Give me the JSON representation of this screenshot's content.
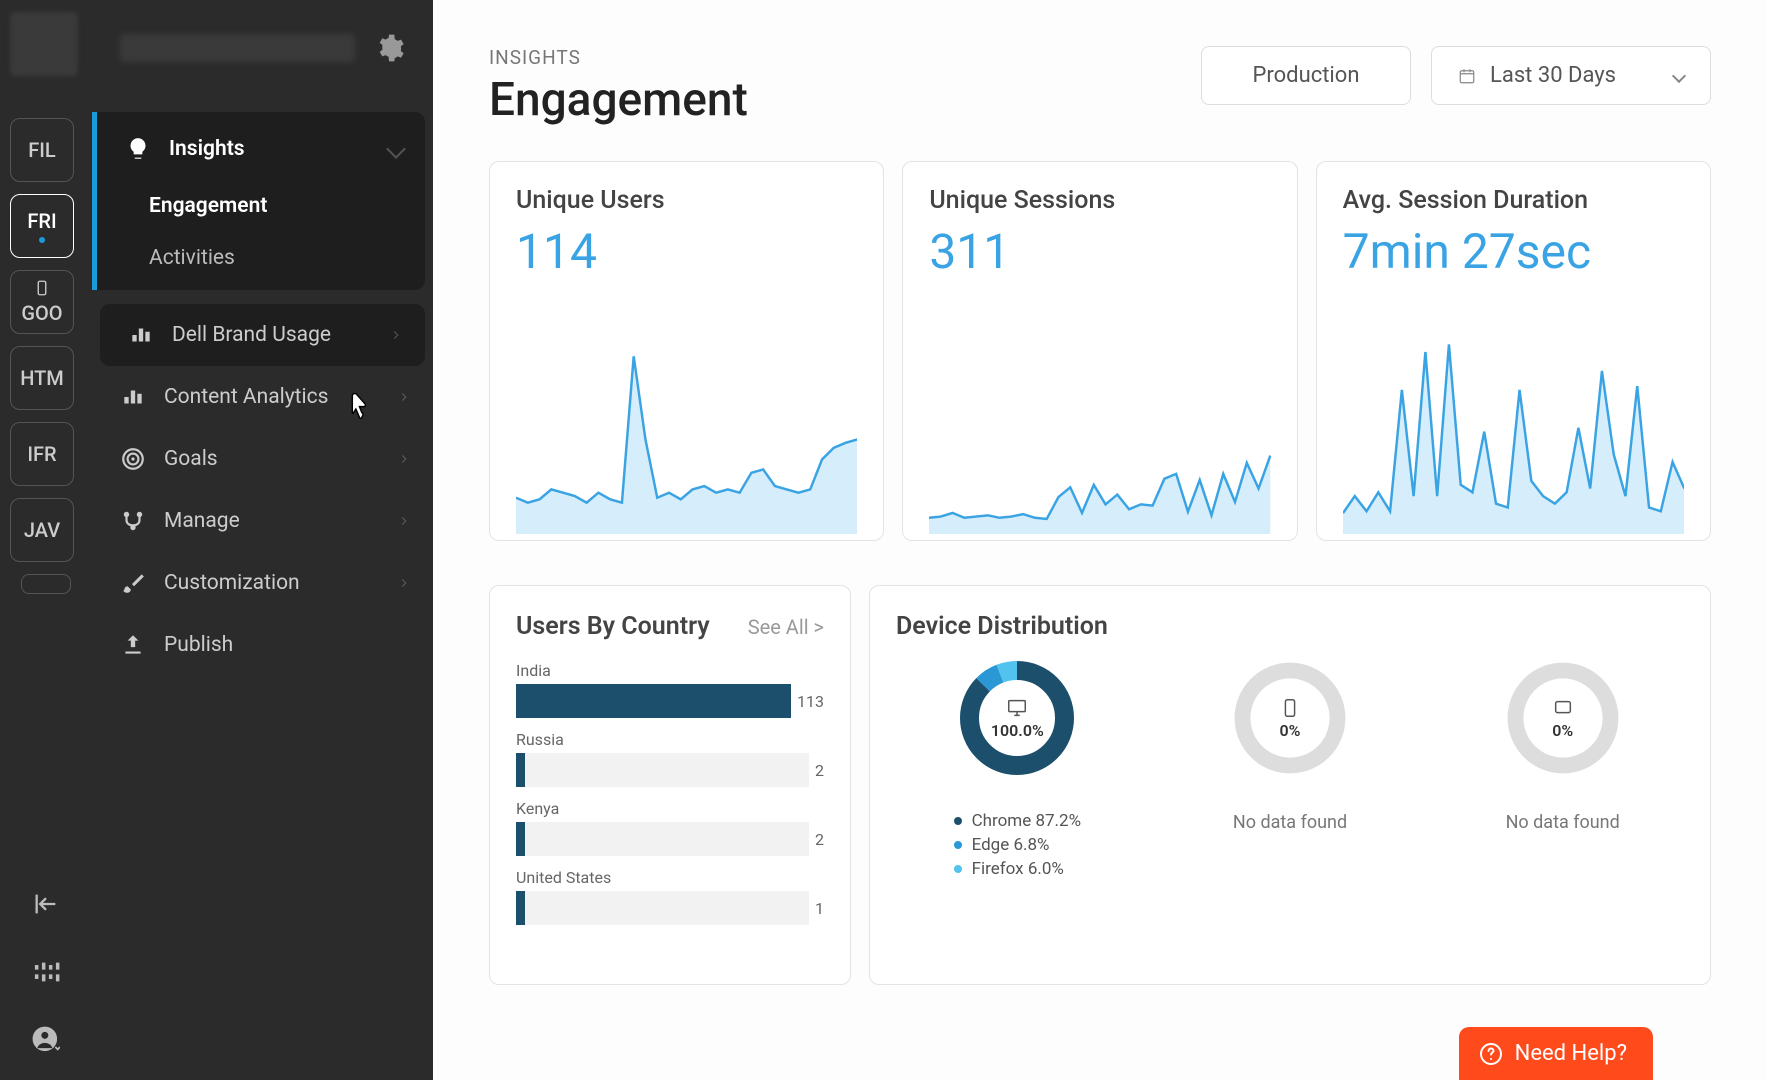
{
  "rail": {
    "tabs": [
      "FIL",
      "FRI",
      "GOO",
      "HTM",
      "IFR",
      "JAV"
    ]
  },
  "sidebar": {
    "items": [
      {
        "label": "Insights",
        "sub": [
          {
            "label": "Engagement"
          },
          {
            "label": "Activities"
          }
        ]
      },
      {
        "label": "Dell Brand Usage"
      },
      {
        "label": "Content Analytics"
      },
      {
        "label": "Goals"
      },
      {
        "label": "Manage"
      },
      {
        "label": "Customization"
      },
      {
        "label": "Publish"
      }
    ]
  },
  "header": {
    "crumb": "INSIGHTS",
    "title": "Engagement",
    "envValue": "Production",
    "rangeValue": "Last 30 Days"
  },
  "cards": [
    {
      "title": "Unique Users",
      "value": "114"
    },
    {
      "title": "Unique Sessions",
      "value": "311"
    },
    {
      "title": "Avg. Session Duration",
      "value": "7min 27sec"
    }
  ],
  "countryPanel": {
    "title": "Users By Country",
    "seeAll": "See All  >"
  },
  "devicePanel": {
    "title": "Device Distribution",
    "desktop": "100.0%",
    "mobile": "0%",
    "tablet": "0%",
    "legend": [
      {
        "label": "Chrome 87.2%",
        "color": "#1b4f6b"
      },
      {
        "label": "Edge 6.8%",
        "color": "#2a98d4"
      },
      {
        "label": "Firefox 6.0%",
        "color": "#52c3ee"
      }
    ],
    "nodata": "No data found"
  },
  "help": "Need Help?",
  "chart_data": [
    {
      "type": "line",
      "title": "Unique Users",
      "values": [
        15,
        12,
        14,
        20,
        18,
        16,
        12,
        18,
        14,
        12,
        100,
        50,
        15,
        18,
        14,
        20,
        22,
        18,
        20,
        18,
        30,
        32,
        22,
        20,
        18,
        20,
        38,
        45,
        48,
        50
      ],
      "ylim": [
        0,
        114
      ]
    },
    {
      "type": "line",
      "title": "Unique Sessions",
      "values": [
        8,
        10,
        16,
        8,
        10,
        12,
        8,
        10,
        14,
        8,
        6,
        42,
        58,
        16,
        62,
        30,
        46,
        22,
        30,
        28,
        72,
        80,
        18,
        70,
        12,
        80,
        34,
        98,
        56,
        110
      ],
      "ylim": [
        0,
        311
      ]
    },
    {
      "type": "line",
      "title": "Avg. Session Duration",
      "values": [
        5,
        14,
        6,
        16,
        6,
        70,
        14,
        90,
        14,
        94,
        20,
        16,
        48,
        10,
        8,
        70,
        22,
        14,
        10,
        16,
        50,
        18,
        80,
        36,
        14,
        72,
        8,
        6,
        32,
        18
      ],
      "ylim": [
        0,
        100
      ]
    },
    {
      "type": "bar",
      "title": "Users By Country",
      "categories": [
        "India",
        "Russia",
        "Kenya",
        "United States"
      ],
      "values": [
        113,
        2,
        2,
        1
      ],
      "ylim": [
        0,
        113
      ]
    },
    {
      "type": "pie",
      "title": "Desktop Browser Share",
      "categories": [
        "Chrome",
        "Edge",
        "Firefox"
      ],
      "values": [
        87.2,
        6.8,
        6.0
      ]
    }
  ]
}
